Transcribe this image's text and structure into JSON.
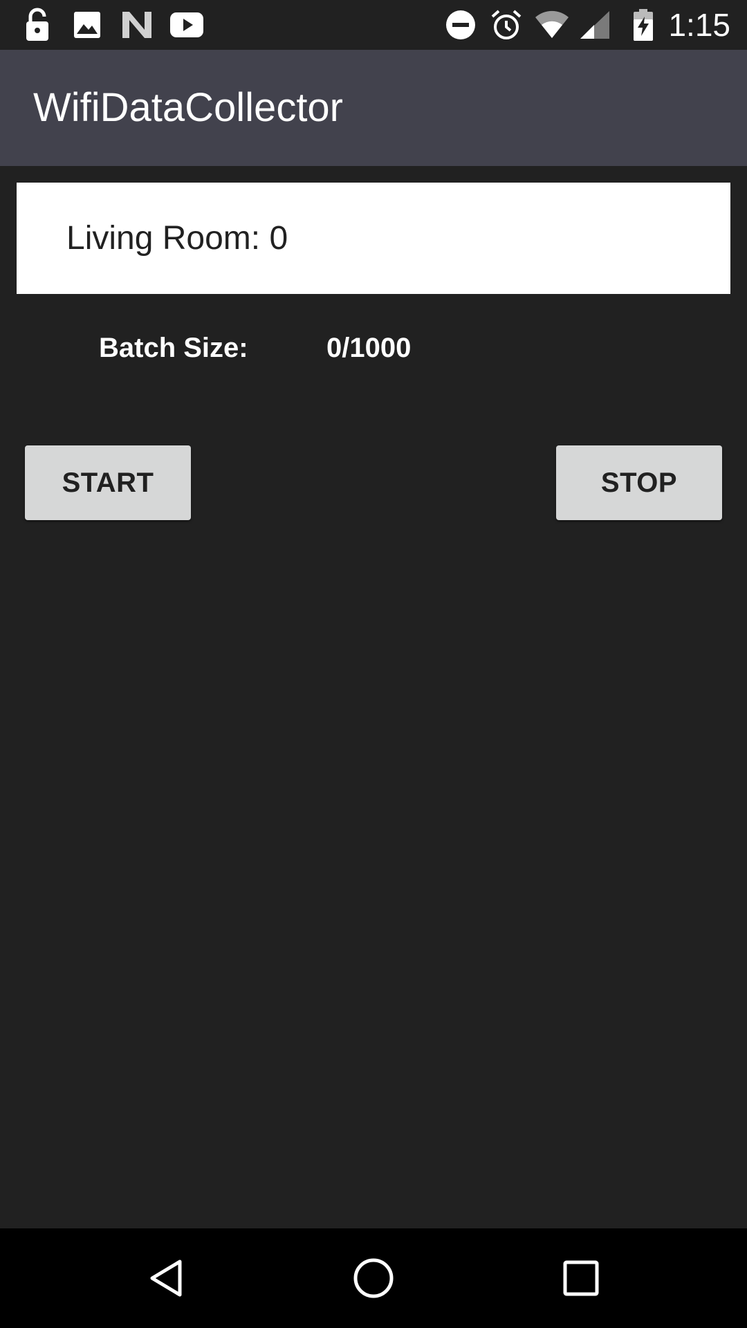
{
  "status_bar": {
    "time": "1:15",
    "left_icons": [
      "lock-open-icon",
      "image-icon",
      "n-logo-icon",
      "youtube-icon"
    ],
    "right_icons": [
      "do-not-disturb-icon",
      "alarm-icon",
      "wifi-icon",
      "cell-signal-icon",
      "battery-charging-icon"
    ]
  },
  "app_bar": {
    "title": "WifiDataCollector"
  },
  "room_selector": {
    "selected": "Living Room: 0"
  },
  "batch": {
    "label": "Batch Size:",
    "value": "0/1000"
  },
  "buttons": {
    "start_label": "START",
    "stop_label": "STOP"
  },
  "nav_bar": {
    "icons": [
      "back-icon",
      "home-icon",
      "recents-icon"
    ]
  },
  "colors": {
    "background": "#212121",
    "app_bar": "#42424d",
    "button": "#d6d7d7",
    "spinner": "#ffffff"
  }
}
